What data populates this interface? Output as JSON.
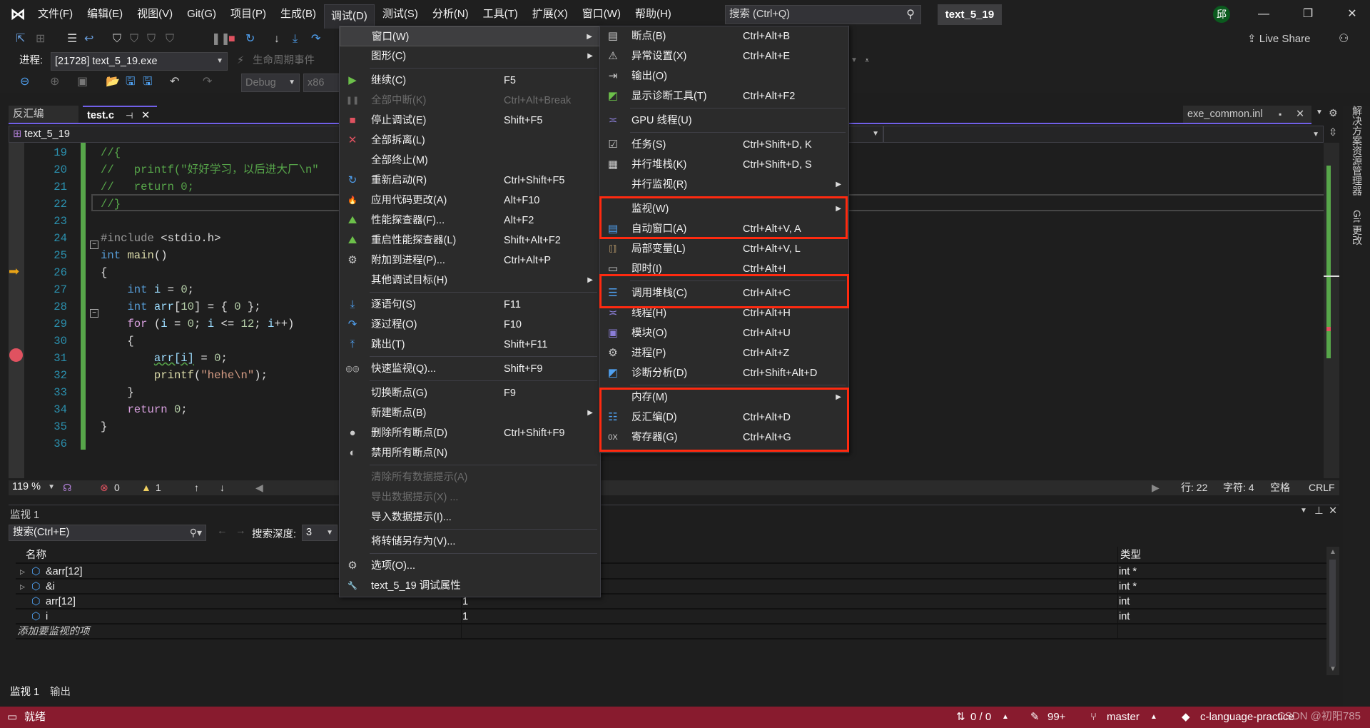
{
  "colors": {
    "accent": "#7160e8",
    "statusbar": "#881b2e",
    "highlight_box": "#ff2a10",
    "breakpoint": "#e05260",
    "change_bar": "#57a64a"
  },
  "titlebar": {
    "logo_icon": "visual-studio-logo",
    "menus": [
      "文件(F)",
      "编辑(E)",
      "视图(V)",
      "Git(G)",
      "项目(P)",
      "生成(B)",
      "调试(D)",
      "测试(S)",
      "分析(N)",
      "工具(T)",
      "扩展(X)",
      "窗口(W)",
      "帮助(H)"
    ],
    "active_menu_index": 6,
    "search_placeholder": "搜索 (Ctrl+Q)",
    "solution_name": "text_5_19",
    "avatar_initial": "邱",
    "minimize": "—",
    "restore": "❐",
    "close": "✕"
  },
  "toolbar": {
    "process_label": "进程:",
    "process_value": "[21728] text_5_19.exe",
    "lifecycle_label": "生命周期事件",
    "config_value": "Debug",
    "platform_value": "x86",
    "live_share": "Live Share"
  },
  "tabs": {
    "left": [
      {
        "label": "反汇编",
        "active": false
      },
      {
        "label": "test.c",
        "active": true
      }
    ],
    "right": {
      "label": "exe_common.inl"
    },
    "nav_scope": "text_5_19"
  },
  "editor": {
    "current_line": 22,
    "execution_line": 26,
    "breakpoint_line": 31,
    "lines": [
      {
        "n": "19",
        "t": [
          [
            "//{",
            "cm"
          ]
        ]
      },
      {
        "n": "20",
        "t": [
          [
            "//   printf(\"好好学习，以后进大厂\\n\"",
            "cm"
          ]
        ]
      },
      {
        "n": "21",
        "t": [
          [
            "//   return 0;",
            "cm"
          ]
        ]
      },
      {
        "n": "22",
        "t": [
          [
            "//}",
            "cm"
          ]
        ]
      },
      {
        "n": "23",
        "t": []
      },
      {
        "n": "24",
        "t": [
          [
            "#include ",
            "pp"
          ],
          [
            "<stdio.h>",
            "pl"
          ]
        ]
      },
      {
        "n": "25",
        "t": [
          [
            "int",
            "kw"
          ],
          [
            " ",
            "pl"
          ],
          [
            "main",
            "fn"
          ],
          [
            "()",
            "pl"
          ]
        ]
      },
      {
        "n": "26",
        "t": [
          [
            "{",
            "pl"
          ]
        ]
      },
      {
        "n": "27",
        "t": [
          [
            "    ",
            "pl"
          ],
          [
            "int",
            "kw"
          ],
          [
            " ",
            "pl"
          ],
          [
            "i",
            "var"
          ],
          [
            " = ",
            "pl"
          ],
          [
            "0",
            "num"
          ],
          [
            ";",
            "pl"
          ]
        ]
      },
      {
        "n": "28",
        "t": [
          [
            "    ",
            "pl"
          ],
          [
            "int",
            "kw"
          ],
          [
            " ",
            "pl"
          ],
          [
            "arr",
            "var"
          ],
          [
            "[",
            "pl"
          ],
          [
            "10",
            "num"
          ],
          [
            "] = { ",
            "pl"
          ],
          [
            "0",
            "num"
          ],
          [
            " };",
            "pl"
          ]
        ]
      },
      {
        "n": "29",
        "t": [
          [
            "    ",
            "pl"
          ],
          [
            "for",
            "ctl"
          ],
          [
            " (",
            "pl"
          ],
          [
            "i",
            "var"
          ],
          [
            " = ",
            "pl"
          ],
          [
            "0",
            "num"
          ],
          [
            "; ",
            "pl"
          ],
          [
            "i",
            "var"
          ],
          [
            " <= ",
            "pl"
          ],
          [
            "12",
            "num"
          ],
          [
            "; ",
            "pl"
          ],
          [
            "i",
            "var"
          ],
          [
            "++)",
            "pl"
          ]
        ]
      },
      {
        "n": "30",
        "t": [
          [
            "    {",
            "pl"
          ]
        ]
      },
      {
        "n": "31",
        "t": [
          [
            "        ",
            "pl"
          ],
          [
            "arr[i]",
            "var sq"
          ],
          [
            " = ",
            "pl"
          ],
          [
            "0",
            "num"
          ],
          [
            ";",
            "pl"
          ]
        ]
      },
      {
        "n": "32",
        "t": [
          [
            "        ",
            "pl"
          ],
          [
            "printf",
            "fn"
          ],
          [
            "(",
            "pl"
          ],
          [
            "\"hehe\\n\"",
            "str"
          ],
          [
            ");",
            "pl"
          ]
        ]
      },
      {
        "n": "33",
        "t": [
          [
            "    }",
            "pl"
          ]
        ]
      },
      {
        "n": "34",
        "t": [
          [
            "    ",
            "pl"
          ],
          [
            "return",
            "ctl"
          ],
          [
            " ",
            "pl"
          ],
          [
            "0",
            "num"
          ],
          [
            ";",
            "pl"
          ]
        ]
      },
      {
        "n": "35",
        "t": [
          [
            "}",
            "pl"
          ]
        ]
      },
      {
        "n": "36",
        "t": []
      }
    ]
  },
  "editor_status": {
    "zoom": "119 %",
    "errors": "0",
    "warnings": "1",
    "line": "行: 22",
    "col": "字符: 4",
    "indent": "空格",
    "eol": "CRLF"
  },
  "watch": {
    "title": "监视 1",
    "search_placeholder": "搜索(Ctrl+E)",
    "depth_label": "搜索深度:",
    "depth_value": "3",
    "columns": [
      "名称",
      "类型"
    ],
    "rows": [
      {
        "name": "&arr[12]",
        "value": "",
        "type": "int *",
        "expandable": true
      },
      {
        "name": "&i",
        "value": "",
        "type": "int *",
        "expandable": true
      },
      {
        "name": "arr[12]",
        "value": "1",
        "type": "int",
        "expandable": false
      },
      {
        "name": "i",
        "value": "1",
        "type": "int",
        "expandable": false
      }
    ],
    "add_item": "添加要监视的项"
  },
  "bottom_tabs": [
    "监视 1",
    "输出"
  ],
  "statusbar": {
    "ready": "就绪",
    "sync": "0 / 0",
    "changes": "99+",
    "branch": "master",
    "repo": "c-language-practice",
    "watermark": "CSDN @初阳785"
  },
  "right_strip": [
    "解决方案资源管理器",
    "Git 更改"
  ],
  "debug_menu": [
    {
      "label": "窗口(W)",
      "arrow": true,
      "sel": true
    },
    {
      "label": "图形(C)",
      "arrow": true
    },
    {
      "sep": true
    },
    {
      "label": "继续(C)",
      "sc": "F5",
      "icon": "play-icon"
    },
    {
      "label": "全部中断(K)",
      "sc": "Ctrl+Alt+Break",
      "icon": "pause-icon",
      "dis": true
    },
    {
      "label": "停止调试(E)",
      "sc": "Shift+F5",
      "icon": "stop-icon"
    },
    {
      "label": "全部拆离(L)",
      "icon": "detach-icon"
    },
    {
      "label": "全部终止(M)"
    },
    {
      "label": "重新启动(R)",
      "sc": "Ctrl+Shift+F5",
      "icon": "restart-icon"
    },
    {
      "label": "应用代码更改(A)",
      "sc": "Alt+F10",
      "icon": "hot-reload-icon"
    },
    {
      "label": "性能探查器(F)...",
      "sc": "Alt+F2",
      "icon": "profiler-icon"
    },
    {
      "label": "重启性能探查器(L)",
      "sc": "Shift+Alt+F2",
      "icon": "profiler-restart-icon"
    },
    {
      "label": "附加到进程(P)...",
      "sc": "Ctrl+Alt+P",
      "icon": "attach-icon"
    },
    {
      "label": "其他调试目标(H)",
      "arrow": true
    },
    {
      "sep": true
    },
    {
      "label": "逐语句(S)",
      "sc": "F11",
      "icon": "step-into-icon"
    },
    {
      "label": "逐过程(O)",
      "sc": "F10",
      "icon": "step-over-icon"
    },
    {
      "label": "跳出(T)",
      "sc": "Shift+F11",
      "icon": "step-out-icon"
    },
    {
      "sep": true
    },
    {
      "label": "快速监视(Q)...",
      "sc": "Shift+F9",
      "icon": "glasses-icon"
    },
    {
      "sep": true
    },
    {
      "label": "切换断点(G)",
      "sc": "F9"
    },
    {
      "label": "新建断点(B)",
      "arrow": true
    },
    {
      "label": "删除所有断点(D)",
      "sc": "Ctrl+Shift+F9",
      "icon": "delete-breakpoints-icon"
    },
    {
      "label": "禁用所有断点(N)",
      "icon": "disable-breakpoints-icon"
    },
    {
      "sep": true
    },
    {
      "label": "清除所有数据提示(A)",
      "dis": true
    },
    {
      "label": "导出数据提示(X) ...",
      "dis": true
    },
    {
      "label": "导入数据提示(I)..."
    },
    {
      "sep": true
    },
    {
      "label": "将转储另存为(V)..."
    },
    {
      "sep": true
    },
    {
      "label": "选项(O)...",
      "icon": "gear-icon"
    },
    {
      "label": "text_5_19 调试属性",
      "icon": "wrench-icon"
    }
  ],
  "window_submenu": [
    {
      "label": "断点(B)",
      "sc": "Ctrl+Alt+B",
      "icon": "breakpoints-window-icon"
    },
    {
      "label": "异常设置(X)",
      "sc": "Ctrl+Alt+E",
      "icon": "exception-icon"
    },
    {
      "label": "输出(O)",
      "icon": "output-icon"
    },
    {
      "label": "显示诊断工具(T)",
      "sc": "Ctrl+Alt+F2",
      "icon": "diagnostics-icon"
    },
    {
      "sep": true
    },
    {
      "label": "GPU 线程(U)",
      "icon": "gpu-threads-icon"
    },
    {
      "sep": true
    },
    {
      "label": "任务(S)",
      "sc": "Ctrl+Shift+D, K",
      "icon": "tasks-icon"
    },
    {
      "label": "并行堆栈(K)",
      "sc": "Ctrl+Shift+D, S",
      "icon": "parallel-stacks-icon"
    },
    {
      "label": "并行监视(R)",
      "arrow": true
    },
    {
      "sep": true
    },
    {
      "label": "监视(W)",
      "arrow": true
    },
    {
      "label": "自动窗口(A)",
      "sc": "Ctrl+Alt+V, A",
      "icon": "autos-icon"
    },
    {
      "label": "局部变量(L)",
      "sc": "Ctrl+Alt+V, L",
      "icon": "locals-icon"
    },
    {
      "label": "即时(I)",
      "sc": "Ctrl+Alt+I",
      "icon": "immediate-icon"
    },
    {
      "sep": true
    },
    {
      "label": "调用堆栈(C)",
      "sc": "Ctrl+Alt+C",
      "icon": "call-stack-icon"
    },
    {
      "label": "线程(H)",
      "sc": "Ctrl+Alt+H",
      "icon": "threads-icon"
    },
    {
      "label": "模块(O)",
      "sc": "Ctrl+Alt+U",
      "icon": "modules-icon"
    },
    {
      "label": "进程(P)",
      "sc": "Ctrl+Alt+Z",
      "icon": "processes-icon"
    },
    {
      "label": "诊断分析(D)",
      "sc": "Ctrl+Shift+Alt+D",
      "icon": "diagnostic-analysis-icon"
    },
    {
      "sep": true
    },
    {
      "label": "内存(M)",
      "arrow": true
    },
    {
      "label": "反汇编(D)",
      "sc": "Ctrl+Alt+D",
      "icon": "disassembly-icon"
    },
    {
      "label": "寄存器(G)",
      "sc": "Ctrl+Alt+G",
      "icon": "registers-icon"
    }
  ]
}
